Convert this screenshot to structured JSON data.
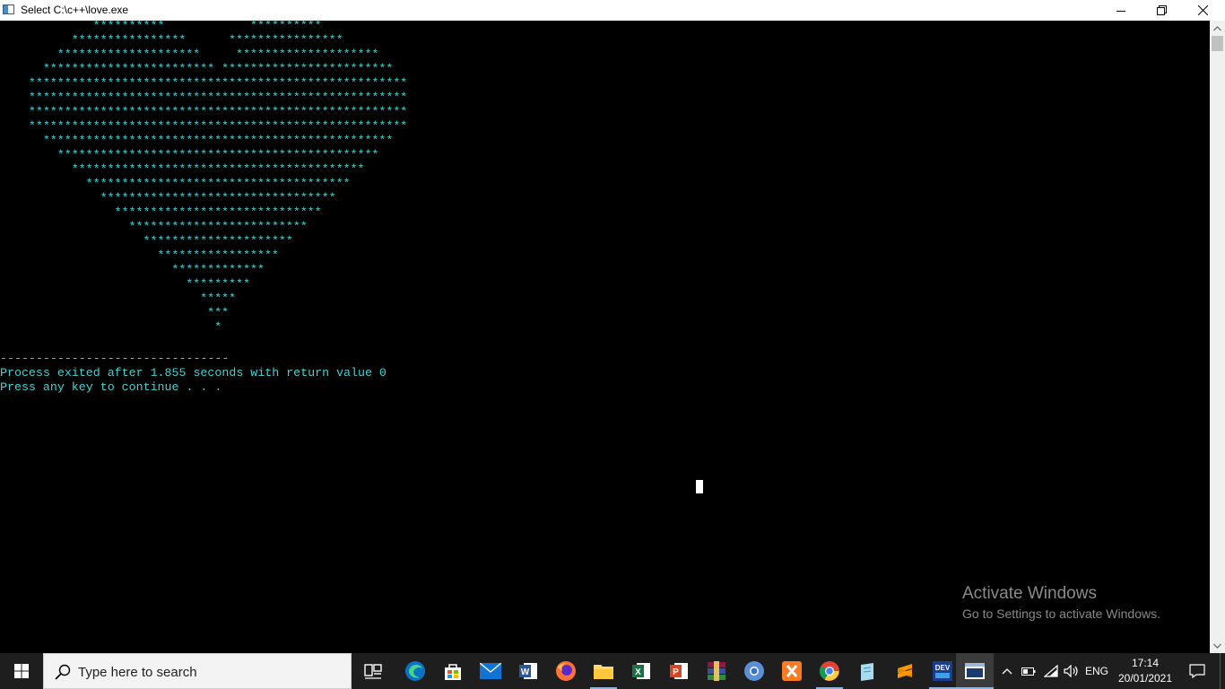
{
  "window": {
    "title": "Select C:\\c++\\love.exe"
  },
  "console": {
    "heart_lines": [
      "             **********            **********",
      "          ****************      ****************",
      "        ********************     ********************",
      "      ************************ ************************",
      "    *****************************************************",
      "    *****************************************************",
      "    *****************************************************",
      "    *****************************************************",
      "      *************************************************",
      "        *********************************************",
      "          *****************************************",
      "            *************************************",
      "              *********************************",
      "                *****************************",
      "                  *************************",
      "                    *********************",
      "                      *****************",
      "                        *************",
      "                          *********",
      "                            *****",
      "                             ***",
      "                              *"
    ],
    "separator": "--------------------------------",
    "exit_message": "Process exited after 1.855 seconds with return value 0",
    "continue_prompt": "Press any key to continue . . ."
  },
  "watermark": {
    "title": "Activate Windows",
    "subtitle": "Go to Settings to activate Windows."
  },
  "taskbar": {
    "search_placeholder": "Type here to search",
    "apps": [
      {
        "name": "task-view",
        "icon": "task-view-icon"
      },
      {
        "name": "edge",
        "icon": "edge-icon"
      },
      {
        "name": "store",
        "icon": "store-icon"
      },
      {
        "name": "mail",
        "icon": "mail-icon"
      },
      {
        "name": "word",
        "icon": "word-icon"
      },
      {
        "name": "firefox",
        "icon": "firefox-icon"
      },
      {
        "name": "file-explorer",
        "icon": "folder-icon"
      },
      {
        "name": "excel",
        "icon": "excel-icon"
      },
      {
        "name": "powerpoint",
        "icon": "powerpoint-icon"
      },
      {
        "name": "winrar",
        "icon": "winrar-icon"
      },
      {
        "name": "chromium",
        "icon": "chromium-icon"
      },
      {
        "name": "xampp",
        "icon": "xampp-icon"
      },
      {
        "name": "chrome",
        "icon": "chrome-icon"
      },
      {
        "name": "notepad",
        "icon": "notepad-icon"
      },
      {
        "name": "sublime-text",
        "icon": "sublime-icon"
      },
      {
        "name": "dev-cpp",
        "icon": "dev-cpp-icon"
      },
      {
        "name": "console-window",
        "icon": "console-icon"
      }
    ],
    "dev_label": "DEV",
    "language": "ENG",
    "time": "17:14",
    "date": "20/01/2021"
  }
}
